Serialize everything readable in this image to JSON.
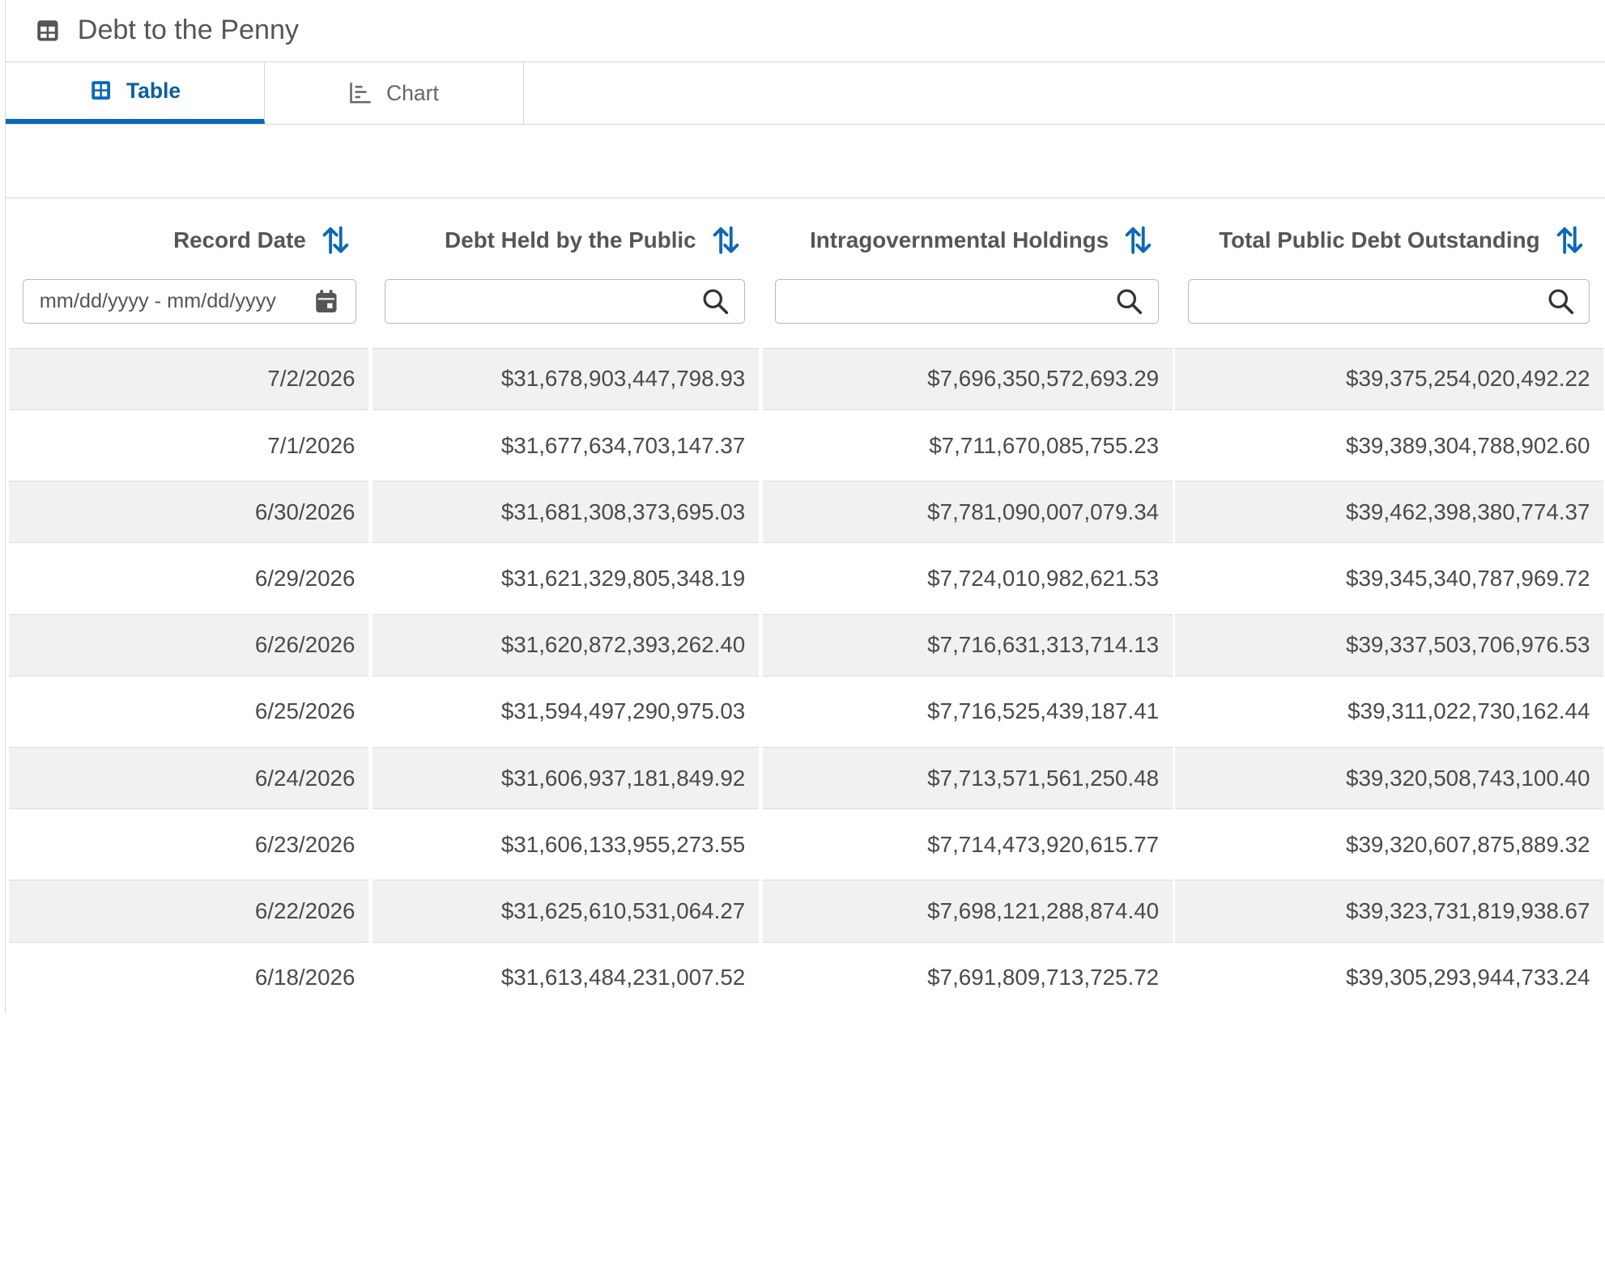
{
  "header": {
    "title": "Debt to the Penny"
  },
  "tabs": [
    {
      "label": "Table",
      "active": true
    },
    {
      "label": "Chart",
      "active": false
    }
  ],
  "accent_color": "#0a68b8",
  "columns": [
    {
      "label": "Record Date",
      "filter_type": "date-range",
      "placeholder": "mm/dd/yyyy - mm/dd/yyyy",
      "value": ""
    },
    {
      "label": "Debt Held by the Public",
      "filter_type": "search",
      "placeholder": "",
      "value": ""
    },
    {
      "label": "Intragovernmental Holdings",
      "filter_type": "search",
      "placeholder": "",
      "value": ""
    },
    {
      "label": "Total Public Debt Outstanding",
      "filter_type": "search",
      "placeholder": "",
      "value": ""
    }
  ],
  "rows": [
    [
      "7/2/2026",
      "$31,678,903,447,798.93",
      "$7,696,350,572,693.29",
      "$39,375,254,020,492.22"
    ],
    [
      "7/1/2026",
      "$31,677,634,703,147.37",
      "$7,711,670,085,755.23",
      "$39,389,304,788,902.60"
    ],
    [
      "6/30/2026",
      "$31,681,308,373,695.03",
      "$7,781,090,007,079.34",
      "$39,462,398,380,774.37"
    ],
    [
      "6/29/2026",
      "$31,621,329,805,348.19",
      "$7,724,010,982,621.53",
      "$39,345,340,787,969.72"
    ],
    [
      "6/26/2026",
      "$31,620,872,393,262.40",
      "$7,716,631,313,714.13",
      "$39,337,503,706,976.53"
    ],
    [
      "6/25/2026",
      "$31,594,497,290,975.03",
      "$7,716,525,439,187.41",
      "$39,311,022,730,162.44"
    ],
    [
      "6/24/2026",
      "$31,606,937,181,849.92",
      "$7,713,571,561,250.48",
      "$39,320,508,743,100.40"
    ],
    [
      "6/23/2026",
      "$31,606,133,955,273.55",
      "$7,714,473,920,615.77",
      "$39,320,607,875,889.32"
    ],
    [
      "6/22/2026",
      "$31,625,610,531,064.27",
      "$7,698,121,288,874.40",
      "$39,323,731,819,938.67"
    ],
    [
      "6/18/2026",
      "$31,613,484,231,007.52",
      "$7,691,809,713,725.72",
      "$39,305,293,944,733.24"
    ]
  ]
}
